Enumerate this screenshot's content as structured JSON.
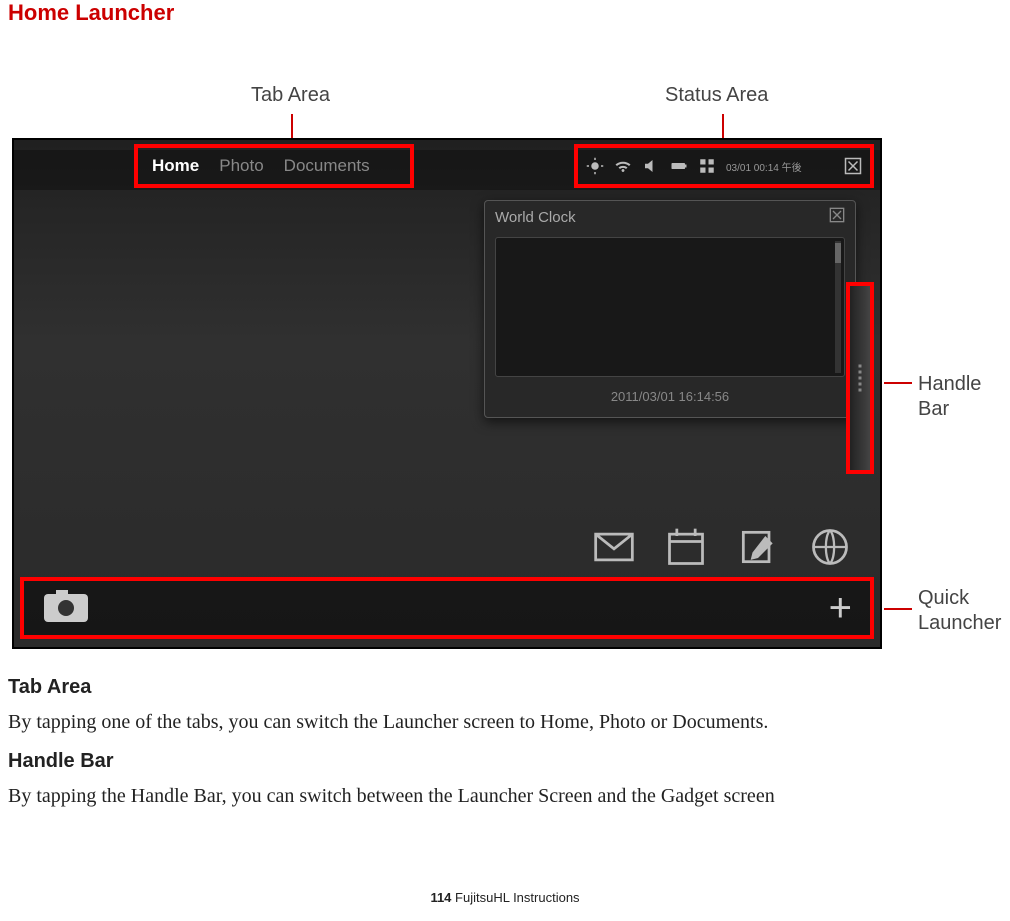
{
  "page": {
    "title": "Home Launcher",
    "footer_pagenum": "114",
    "footer_text": " FujitsuHL Instructions"
  },
  "labels": {
    "tab_area": "Tab Area",
    "status_area": "Status Area",
    "handle_bar": "Handle Bar",
    "quick_launcher": "Quick Launcher"
  },
  "screenshot": {
    "tabs": {
      "home": "Home",
      "photo": "Photo",
      "documents": "Documents"
    },
    "status_time": "03/01 00:14 午後",
    "world_clock": {
      "title": "World Clock",
      "timestamp": "2011/03/01 16:14:56"
    },
    "icons": {
      "brightness": "brightness-icon",
      "wifi": "wifi-icon",
      "volume": "volume-icon",
      "battery": "battery-icon",
      "grid": "grid-icon",
      "close": "close-icon",
      "mail": "mail-icon",
      "calendar": "calendar-icon",
      "note": "note-icon",
      "world": "world-icon",
      "camera": "camera-icon",
      "plus": "+"
    }
  },
  "sections": {
    "tab_area": {
      "heading": "Tab Area",
      "text": "By tapping one of the tabs, you can switch the Launcher screen to Home, Photo or Documents."
    },
    "handle_bar": {
      "heading": "Handle Bar",
      "text": "By tapping the Handle Bar, you can switch between the Launcher Screen and the Gadget screen"
    }
  }
}
